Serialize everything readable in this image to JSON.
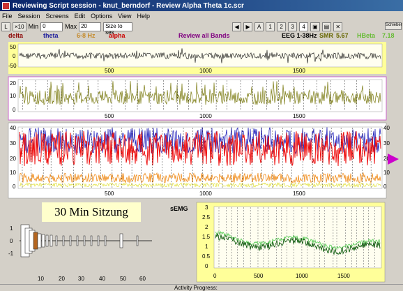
{
  "window": {
    "title": "Reviewing Script session - knut_berndorf - Review Alpha Theta 1c.scr"
  },
  "menu": [
    "File",
    "Session",
    "Screens",
    "Edit",
    "Options",
    "View",
    "Help"
  ],
  "toolbar": {
    "btn1": "L",
    "btn2": "×10",
    "min_label": "Min",
    "min_value": "0",
    "max_label": "Max",
    "max_value": "20",
    "size_select": "Size to ses",
    "letter_a": "A",
    "pages": [
      "1",
      "2",
      "3",
      "4"
    ],
    "schieber": "Schieber"
  },
  "bands": {
    "delta": "delta",
    "theta": "theta",
    "hz68": "6-8 Hz",
    "alpha": "alpha",
    "review_all": "Review all Bands",
    "eeg": "EEG 1-38Hz",
    "smr_label": "SMR",
    "smr_value": "5.67",
    "hbeta_label": "HBeta",
    "hbeta_value": "7.18",
    "colors": {
      "delta": "#8b0000",
      "theta": "#1c1c9c",
      "hz68": "#c58a2a",
      "alpha": "#cc0000",
      "review": "#800080",
      "hbeta": "#66bb33",
      "smr": "#666600"
    }
  },
  "panel1": {
    "y_ticks": [
      "50",
      "0",
      "-50"
    ],
    "x_ticks": [
      "500",
      "1000",
      "1500"
    ]
  },
  "panel2": {
    "y_ticks": [
      "20",
      "10",
      "0"
    ],
    "x_ticks": [
      "500",
      "1000",
      "1500"
    ]
  },
  "panel3": {
    "y_ticks": [
      "40",
      "30",
      "20",
      "10",
      "0"
    ],
    "y_ticks_right": [
      "40",
      "30",
      "20",
      "10",
      "0"
    ],
    "x_ticks": [
      "500",
      "1000",
      "1500"
    ]
  },
  "sitzung": "30 Min Sitzung",
  "semg": {
    "label": "sEMG",
    "y_ticks": [
      "3",
      "2.5",
      "2",
      "1.5",
      "1",
      "0.5",
      "0"
    ],
    "x_ticks": [
      "0",
      "500",
      "1000",
      "1500"
    ]
  },
  "histogram": {
    "y_ticks": [
      "1",
      "0",
      "-1"
    ],
    "x_ticks": [
      "10",
      "20",
      "30",
      "40",
      "50",
      "60"
    ]
  },
  "status": {
    "activity": "Activity Progress:"
  }
}
